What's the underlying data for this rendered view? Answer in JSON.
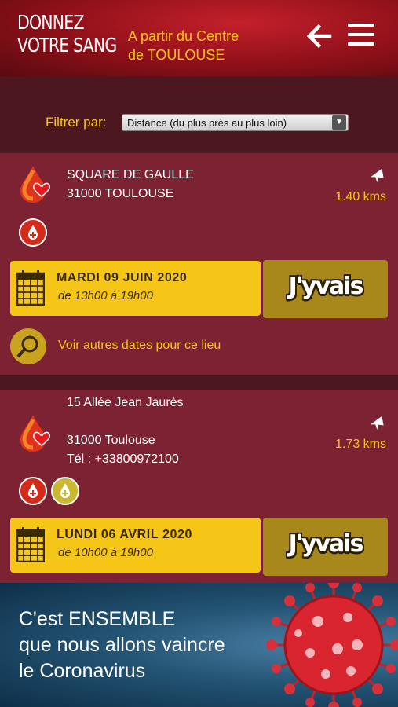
{
  "header": {
    "logo_line1": "DONNEZ",
    "logo_line2": "VOTRE SANG",
    "centre_line1": "A partir du Centre",
    "centre_line2": "de TOULOUSE"
  },
  "filter": {
    "label": "Filtrer par:",
    "selected": "Distance (du plus près au plus loin)"
  },
  "collectes": [
    {
      "address_line1": "SQUARE DE GAULLE",
      "address_line2": "31000 TOULOUSE",
      "distance": "1.40 kms",
      "date": "MARDI 09 JUIN 2020",
      "hours": "de 13h00 à 19h00",
      "button": "J'yvais",
      "other_dates": "Voir autres dates pour ce lieu"
    },
    {
      "address_line1": "15 Allée Jean Jaurès",
      "address_line2": "31000 Toulouse",
      "phone": "Tél : +33800972100",
      "distance": "1.73 kms",
      "date": "LUNDI 06 AVRIL 2020",
      "hours": "de 10h00 à 19h00",
      "button": "J'yvais"
    }
  ],
  "banner": {
    "line1": "C'est ENSEMBLE",
    "line2": "que nous allons vaincre",
    "line3": "le Coronavirus"
  },
  "colors": {
    "accent_yellow": "#f5c518",
    "card_bg": "#7d2233",
    "header_red": "#b0141e"
  },
  "icons": [
    "back-arrow-icon",
    "menu-icon",
    "blood-drop-heart-icon",
    "airplane-icon",
    "whole-blood-icon",
    "plasma-icon",
    "calendar-icon",
    "search-icon",
    "coronavirus-icon"
  ]
}
